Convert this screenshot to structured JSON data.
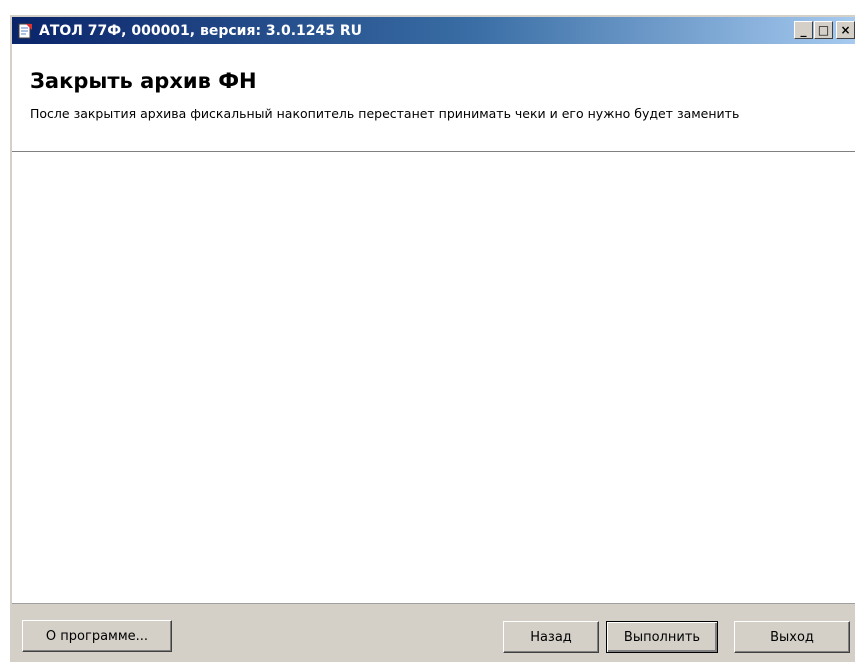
{
  "window": {
    "title": "АТОЛ 77Ф, 000001, версия: 3.0.1245 RU",
    "icon": "app-document-icon",
    "controls": {
      "minimize": "_",
      "maximize": "□",
      "close": "×"
    }
  },
  "header": {
    "title": "Закрыть архив ФН",
    "description": "После закрытия архива фискальный накопитель перестанет принимать чеки и его нужно будет заменить"
  },
  "footer": {
    "about_label": "О программе...",
    "back_label": "Назад",
    "run_label": "Выполнить",
    "exit_label": "Выход"
  },
  "colors": {
    "titlebar_start": "#0a246a",
    "titlebar_end": "#a6caf0",
    "window_face": "#d4d0c8"
  }
}
